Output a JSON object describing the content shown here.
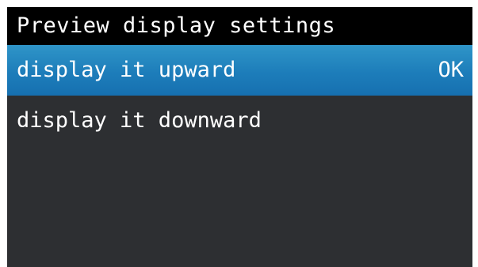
{
  "header": {
    "title": "Preview display settings"
  },
  "menu": {
    "items": [
      {
        "label": "display it upward",
        "status": "OK",
        "selected": true
      },
      {
        "label": "display it downward",
        "status": "",
        "selected": false
      }
    ]
  },
  "colors": {
    "background": "#2d2f32",
    "title_bar": "#000000",
    "selected_item": "#1d7dba",
    "text": "#ffffff"
  }
}
